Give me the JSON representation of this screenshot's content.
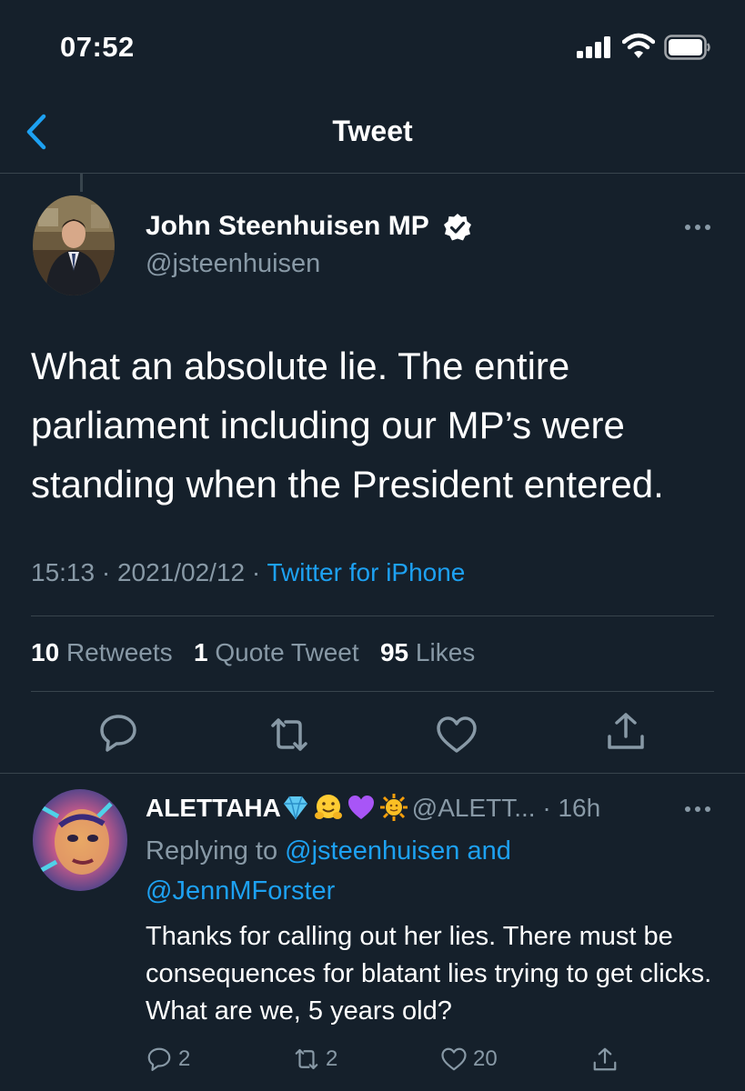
{
  "status_bar": {
    "time": "07:52"
  },
  "nav": {
    "title": "Tweet"
  },
  "tweet": {
    "author_name": "John Steenhuisen MP",
    "handle": "@jsteenhuisen",
    "text": "What an absolute lie. The entire parliament including our MP’s were standing when the President entered.",
    "time": "15:13",
    "date": "2021/02/12",
    "separator": "·",
    "source": "Twitter for iPhone",
    "stats": {
      "retweets_count": "10",
      "retweets_label": "Retweets",
      "quotes_count": "1",
      "quotes_label": "Quote Tweet",
      "likes_count": "95",
      "likes_label": "Likes"
    },
    "actions": [
      "reply-icon",
      "retweet-icon",
      "like-icon",
      "share-icon"
    ]
  },
  "reply": {
    "author_name": "ALETTAHA",
    "emojis": [
      "gem-icon",
      "hugging-face-icon",
      "purple-heart-icon",
      "sun-icon"
    ],
    "handle": "@ALETT...",
    "time": "· 16h",
    "replying_prefix": "Replying to",
    "mention1": "@jsteenhuisen",
    "and_text": "and",
    "mention2": "@JennMForster",
    "text": "Thanks for calling out her lies. There must be consequences for blatant lies trying to get clicks. What are we, 5 years old?",
    "reply_count": "2",
    "retweet_count": "2",
    "like_count": "20"
  },
  "colors": {
    "background": "#15202b",
    "divider": "#38444d",
    "secondary_text": "#8899a6",
    "accent": "#1da1f2"
  }
}
